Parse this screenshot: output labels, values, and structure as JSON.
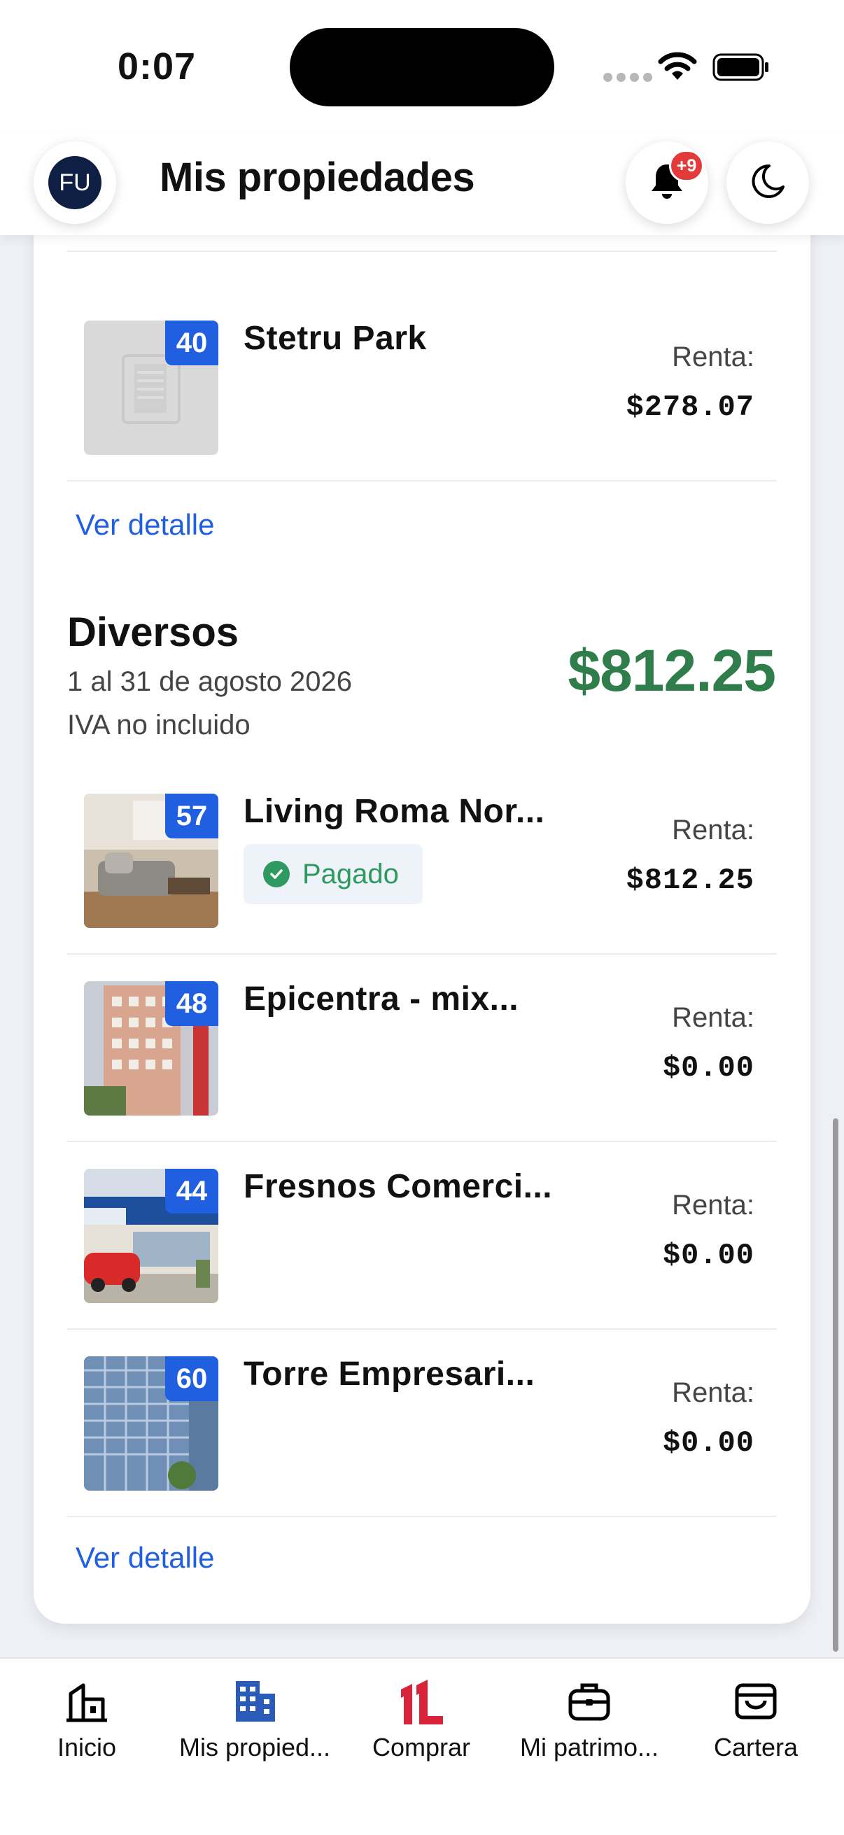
{
  "status_bar": {
    "time": "0:07"
  },
  "header": {
    "avatar_initials": "FU",
    "title": "Mis propiedades",
    "notification_count": "+9"
  },
  "top_section": {
    "items": [
      {
        "id": "40",
        "name": "Stetru Park",
        "rent_label": "Renta:",
        "rent_value": "$278.07",
        "image": "placeholder-building"
      }
    ],
    "detail_link": "Ver detalle"
  },
  "section": {
    "title": "Diversos",
    "dates": "1 al 31 de agosto 2026",
    "tax_note": "IVA no incluido",
    "total": "$812.25",
    "total_color": "#2f7d4a",
    "items": [
      {
        "id": "57",
        "name": "Living Roma Nor...",
        "status": "Pagado",
        "rent_label": "Renta:",
        "rent_value": "$812.25",
        "image": "living-room-photo"
      },
      {
        "id": "48",
        "name": "Epicentra - mix...",
        "rent_label": "Renta:",
        "rent_value": "$0.00",
        "image": "building-photo"
      },
      {
        "id": "44",
        "name": "Fresnos Comerci...",
        "rent_label": "Renta:",
        "rent_value": "$0.00",
        "image": "storefront-photo"
      },
      {
        "id": "60",
        "name": "Torre Empresari...",
        "rent_label": "Renta:",
        "rent_value": "$0.00",
        "image": "tower-photo"
      }
    ],
    "detail_link": "Ver detalle"
  },
  "bottom_nav": {
    "items": [
      {
        "label": "Inicio",
        "icon": "home-icon"
      },
      {
        "label": "Mis propied...",
        "icon": "buildings-icon"
      },
      {
        "label": "Comprar",
        "icon": "brand-logo-icon"
      },
      {
        "label": "Mi patrimo...",
        "icon": "briefcase-icon"
      },
      {
        "label": "Cartera",
        "icon": "wallet-icon"
      }
    ]
  },
  "colors": {
    "accent_blue": "#1f5fe0",
    "paid_green": "#2f9a5f",
    "brand_red": "#d8233a",
    "notification_red": "#e33a3a"
  }
}
